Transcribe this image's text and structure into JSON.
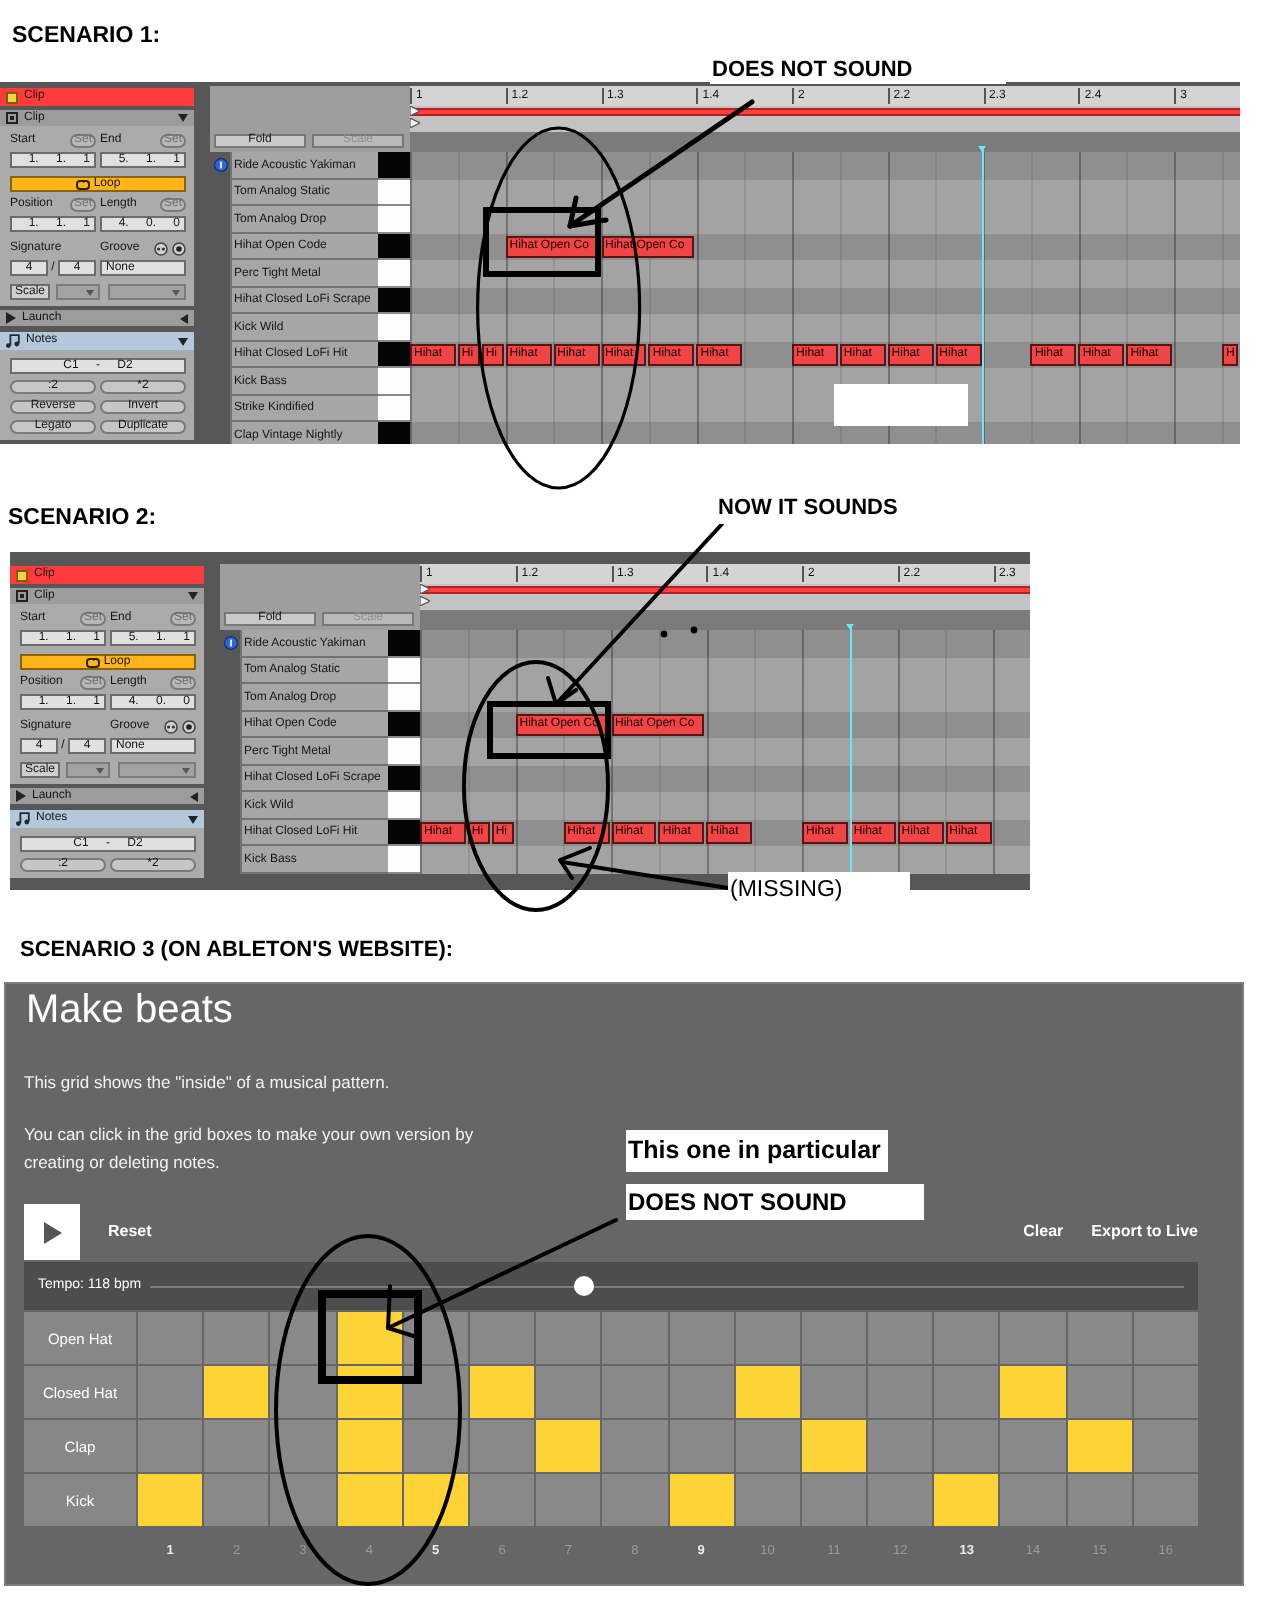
{
  "scenarios": [
    {
      "kind": "live_clip",
      "heading": "SCENARIO 1:",
      "annotations": [
        {
          "kind": "label",
          "text": "DOES NOT SOUND"
        },
        {
          "kind": "arrow"
        },
        {
          "kind": "box"
        },
        {
          "kind": "ellipse"
        },
        {
          "kind": "blank"
        }
      ],
      "clip_panel": {
        "title": "Clip",
        "clip_section": {
          "label": "Clip",
          "expanded": true,
          "start": {
            "label": "Start",
            "button": "Set",
            "value": "1. 1. 1"
          },
          "end": {
            "label": "End",
            "button": "Set",
            "value": "5. 1. 1"
          },
          "loop": {
            "label": "Loop",
            "on": true
          },
          "position": {
            "label": "Position",
            "button": "Set",
            "value": "1. 1. 1"
          },
          "length": {
            "label": "Length",
            "button": "Set",
            "value": "4. 0. 0"
          },
          "signature": {
            "label": "Signature",
            "numerator": "4",
            "separator": "/",
            "denominator": "4"
          },
          "groove": {
            "label": "Groove",
            "value": "None"
          },
          "scale": {
            "button": "Scale"
          }
        },
        "launch_section": {
          "label": "Launch",
          "expanded": false
        },
        "notes_section": {
          "label": "Notes",
          "expanded": true,
          "range": "C1 - D2",
          "buttons": [
            ":2",
            "*2",
            "Reverse",
            "Invert",
            "Legato",
            "Duplicate"
          ]
        }
      },
      "fold_button": {
        "label": "Fold"
      },
      "scale_button": {
        "label": "Scale",
        "disabled": true
      },
      "ruler": [
        "1",
        "1.2",
        "1.3",
        "1.4",
        "2",
        "2.2",
        "2.3",
        "2.4",
        "3"
      ],
      "playhead": {
        "level": 0.69
      },
      "lanes": [
        {
          "name": "Ride Acoustic Yakiman",
          "black_key": true,
          "selected": true
        },
        {
          "name": "Tom Analog Static",
          "black_key": false,
          "selected": false
        },
        {
          "name": "Tom Analog Drop",
          "black_key": false,
          "selected": false
        },
        {
          "name": "Hihat Open Code",
          "black_key": true,
          "selected": false,
          "notes": [
            {
              "kind": "quarter_rest"
            },
            {
              "kind": "quarter",
              "label": "Hihat Open Co"
            },
            {
              "kind": "quarter",
              "label": "Hihat Open Co"
            }
          ]
        },
        {
          "name": "Perc Tight Metal",
          "black_key": false,
          "selected": false
        },
        {
          "name": "Hihat Closed LoFi Scrape",
          "black_key": true,
          "selected": false
        },
        {
          "name": "Kick Wild",
          "black_key": false,
          "selected": false
        },
        {
          "name": "Hihat Closed LoFi Hit",
          "black_key": true,
          "selected": false,
          "notes": [
            {
              "kind": "eighth",
              "label": "Hihat"
            },
            {
              "kind": "sixteenth",
              "label": "Hi"
            },
            {
              "kind": "sixteenth",
              "label": "Hi"
            },
            {
              "kind": "eighth",
              "label": "Hihat"
            },
            {
              "kind": "eighth",
              "label": "Hihat"
            },
            {
              "kind": "eighth",
              "label": "Hihat"
            },
            {
              "kind": "eighth",
              "label": "Hihat"
            },
            {
              "kind": "eighth",
              "label": "Hihat"
            },
            {
              "kind": "eighth_rest"
            },
            {
              "kind": "eighth",
              "label": "Hihat"
            },
            {
              "kind": "eighth",
              "label": "Hihat"
            },
            {
              "kind": "eighth",
              "label": "Hihat"
            },
            {
              "kind": "eighth",
              "label": "Hihat"
            },
            {
              "kind": "eighth_rest"
            },
            {
              "kind": "eighth",
              "label": "Hihat"
            },
            {
              "kind": "eighth",
              "label": "Hihat"
            },
            {
              "kind": "eighth",
              "label": "Hihat"
            },
            {
              "kind": "eighth_rest"
            },
            {
              "kind": "eighth",
              "label": "H"
            }
          ]
        },
        {
          "name": "Kick Bass",
          "black_key": false,
          "selected": false
        },
        {
          "name": "Strike Kindified",
          "black_key": false,
          "selected": false
        },
        {
          "name": "Clap Vintage Nightly",
          "black_key": true,
          "selected": false
        }
      ]
    },
    {
      "kind": "live_clip",
      "heading": "SCENARIO 2:",
      "annotations": [
        {
          "kind": "label",
          "text": "NOW IT SOUNDS"
        },
        {
          "kind": "arrow"
        },
        {
          "kind": "dot"
        },
        {
          "kind": "dot"
        },
        {
          "kind": "box"
        },
        {
          "kind": "ellipse"
        },
        {
          "kind": "label",
          "text": "(MISSING)"
        },
        {
          "kind": "arrow"
        }
      ],
      "clip_panel": {
        "title": "Clip",
        "clip_section": {
          "label": "Clip",
          "expanded": true,
          "start": {
            "label": "Start",
            "button": "Set",
            "value": "1. 1. 1"
          },
          "end": {
            "label": "End",
            "button": "Set",
            "value": "5. 1. 1"
          },
          "loop": {
            "label": "Loop",
            "on": true
          },
          "position": {
            "label": "Position",
            "button": "Set",
            "value": "1. 1. 1"
          },
          "length": {
            "label": "Length",
            "button": "Set",
            "value": "4. 0. 0"
          },
          "signature": {
            "label": "Signature",
            "numerator": "4",
            "separator": "/",
            "denominator": "4"
          },
          "groove": {
            "label": "Groove",
            "value": "None"
          },
          "scale": {
            "button": "Scale"
          }
        },
        "launch_section": {
          "label": "Launch",
          "expanded": false
        },
        "notes_section": {
          "label": "Notes",
          "expanded": true,
          "range": "C1 - D2",
          "buttons": [
            ":2",
            "*2"
          ]
        }
      },
      "fold_button": {
        "label": "Fold"
      },
      "scale_button": {
        "label": "Scale",
        "disabled": true
      },
      "ruler": [
        "1",
        "1.2",
        "1.3",
        "1.4",
        "2",
        "2.2",
        "2.3"
      ],
      "playhead": {
        "level": 0.705
      },
      "lanes": [
        {
          "name": "Ride Acoustic Yakiman",
          "black_key": true,
          "selected": true
        },
        {
          "name": "Tom Analog Static",
          "black_key": false,
          "selected": false
        },
        {
          "name": "Tom Analog Drop",
          "black_key": false,
          "selected": false
        },
        {
          "name": "Hihat Open Code",
          "black_key": true,
          "selected": false,
          "notes": [
            {
              "kind": "quarter_rest"
            },
            {
              "kind": "quarter",
              "label": "Hihat Open Co"
            },
            {
              "kind": "quarter",
              "label": "Hihat Open Co"
            }
          ]
        },
        {
          "name": "Perc Tight Metal",
          "black_key": false,
          "selected": false
        },
        {
          "name": "Hihat Closed LoFi Scrape",
          "black_key": true,
          "selected": false
        },
        {
          "name": "Kick Wild",
          "black_key": false,
          "selected": false
        },
        {
          "name": "Hihat Closed LoFi Hit",
          "black_key": true,
          "selected": false,
          "notes": [
            {
              "kind": "eighth",
              "label": "Hihat"
            },
            {
              "kind": "sixteenth",
              "label": "Hi"
            },
            {
              "kind": "sixteenth",
              "label": "Hi"
            },
            {
              "kind": "eighth_rest"
            },
            {
              "kind": "eighth",
              "label": "Hihat"
            },
            {
              "kind": "eighth",
              "label": "Hihat"
            },
            {
              "kind": "eighth",
              "label": "Hihat"
            },
            {
              "kind": "eighth",
              "label": "Hihat"
            },
            {
              "kind": "eighth_rest"
            },
            {
              "kind": "eighth",
              "label": "Hihat"
            },
            {
              "kind": "eighth",
              "label": "Hihat"
            },
            {
              "kind": "eighth",
              "label": "Hihat"
            },
            {
              "kind": "eighth",
              "label": "Hihat"
            }
          ]
        },
        {
          "name": "Kick Bass",
          "black_key": false,
          "selected": false
        }
      ]
    },
    {
      "kind": "web_grid",
      "heading": "SCENARIO 3 (ON ABLETON'S WEBSITE):",
      "annotations": [
        {
          "kind": "label",
          "text": "This one in particular"
        },
        {
          "kind": "label",
          "text": "DOES NOT SOUND"
        },
        {
          "kind": "arrow"
        },
        {
          "kind": "box"
        },
        {
          "kind": "ellipse"
        }
      ],
      "app": {
        "title": "Make beats",
        "intro": "This grid shows the \"inside\" of a musical pattern.",
        "instructions": "You can click in the grid boxes to make your own version by creating or deleting notes.",
        "reset": "Reset",
        "actions": [
          "Clear",
          "Export to Live"
        ],
        "tempo": {
          "label": "Tempo: 118 bpm",
          "level": 0.42
        },
        "rows": [
          {
            "label": "Open Hat",
            "on": [
              false,
              false,
              false,
              true,
              false,
              false,
              false,
              false,
              false,
              false,
              false,
              false,
              false,
              false,
              false,
              false
            ]
          },
          {
            "label": "Closed Hat",
            "on": [
              false,
              true,
              false,
              true,
              false,
              true,
              false,
              false,
              false,
              true,
              false,
              false,
              false,
              true,
              false,
              false
            ]
          },
          {
            "label": "Clap",
            "on": [
              false,
              false,
              false,
              true,
              false,
              false,
              true,
              false,
              false,
              false,
              true,
              false,
              false,
              false,
              true,
              false
            ]
          },
          {
            "label": "Kick",
            "on": [
              true,
              false,
              false,
              true,
              true,
              false,
              false,
              false,
              true,
              false,
              false,
              false,
              true,
              false,
              false,
              false
            ]
          }
        ],
        "steps": [
          {
            "label": "1",
            "highlighted": true
          },
          {
            "label": "2",
            "highlighted": false
          },
          {
            "label": "3",
            "highlighted": false
          },
          {
            "label": "4",
            "highlighted": false
          },
          {
            "label": "5",
            "highlighted": true
          },
          {
            "label": "6",
            "highlighted": false
          },
          {
            "label": "7",
            "highlighted": false
          },
          {
            "label": "8",
            "highlighted": false
          },
          {
            "label": "9",
            "highlighted": true
          },
          {
            "label": "10",
            "highlighted": false
          },
          {
            "label": "11",
            "highlighted": false
          },
          {
            "label": "12",
            "highlighted": false
          },
          {
            "label": "13",
            "highlighted": true
          },
          {
            "label": "14",
            "highlighted": false
          },
          {
            "label": "15",
            "highlighted": false
          },
          {
            "label": "16",
            "highlighted": false
          }
        ]
      }
    }
  ]
}
